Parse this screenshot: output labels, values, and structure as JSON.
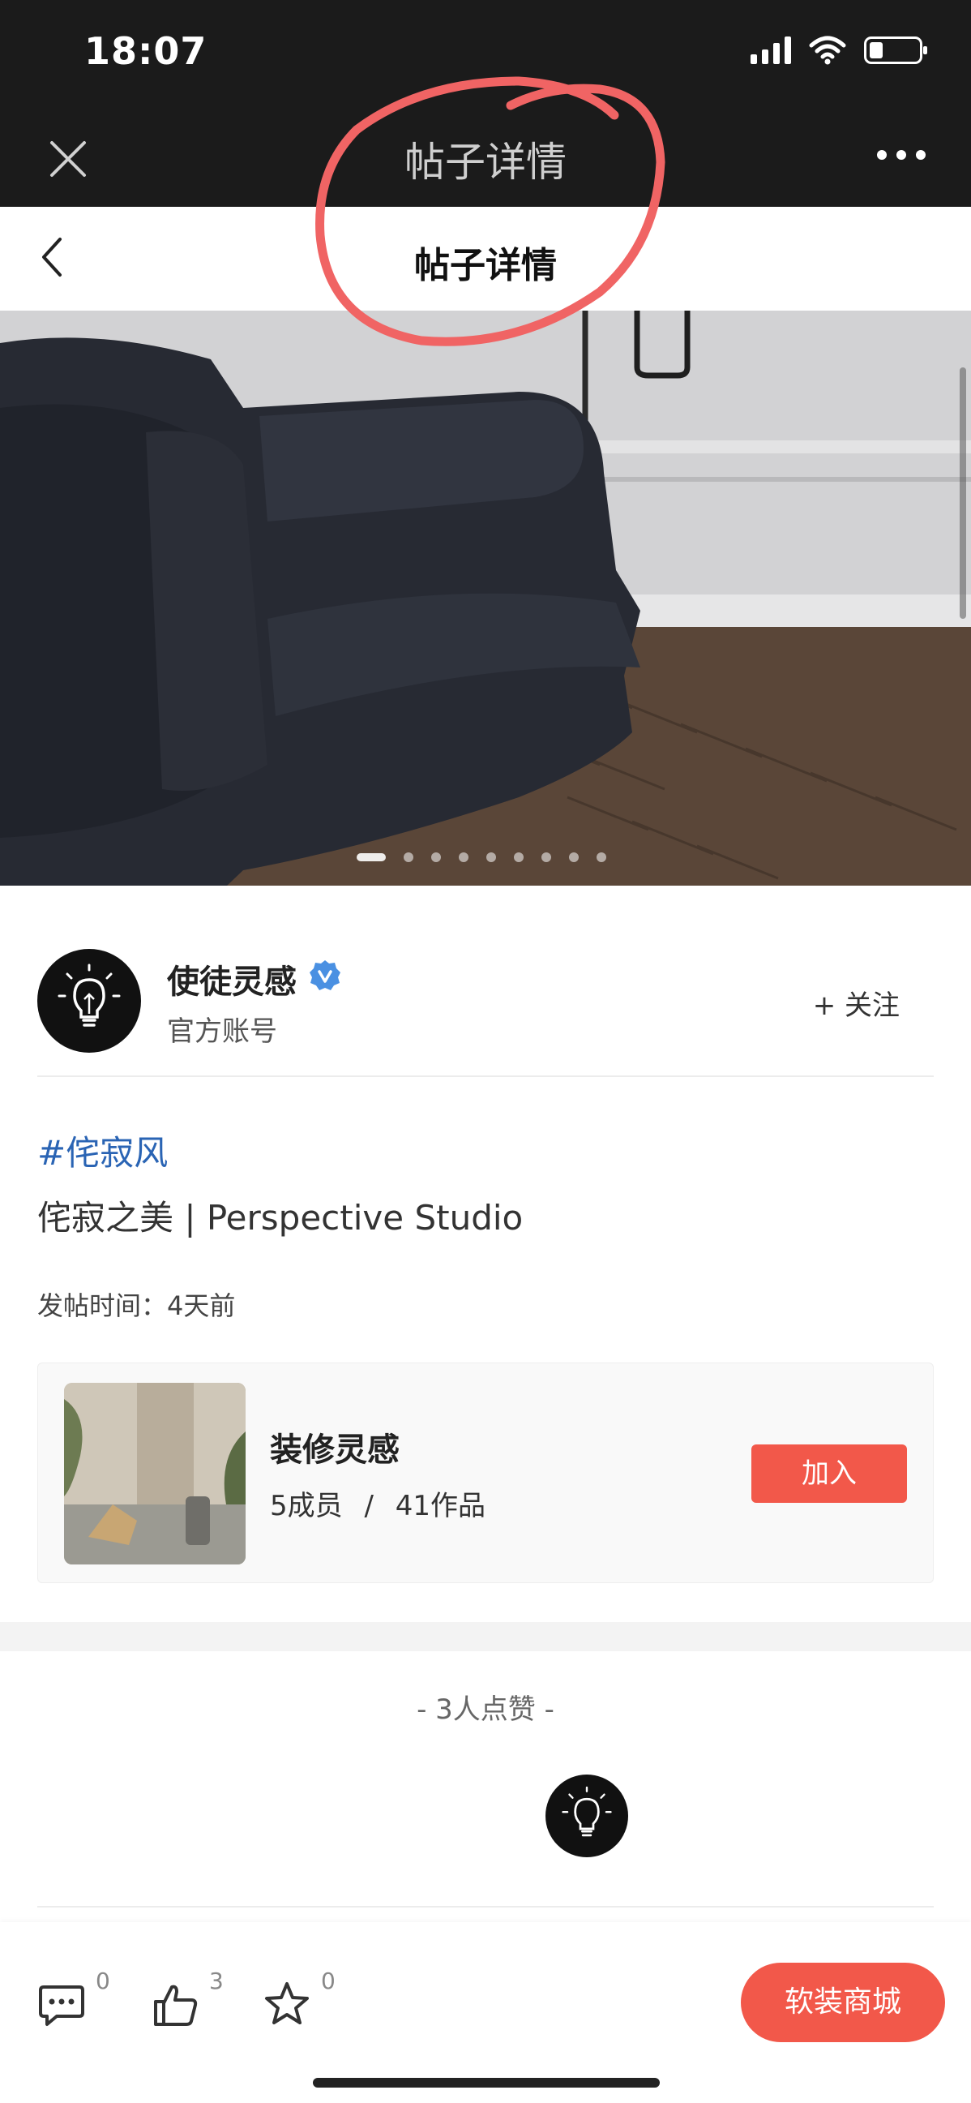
{
  "status_bar": {
    "time": "18:07"
  },
  "wechat_bar": {
    "title": "帖子详情"
  },
  "header": {
    "title": "帖子详情"
  },
  "hero": {
    "image_count": 9,
    "active_index": 0
  },
  "author": {
    "name": "使徒灵感",
    "subtitle": "官方账号",
    "follow_label": "+ 关注"
  },
  "post": {
    "hashtag": "#侘寂风",
    "text": "侘寂之美 | Perspective Studio",
    "time_label": "发帖时间：",
    "time_value": "4天前"
  },
  "community": {
    "title": "装修灵感",
    "members": "5成员",
    "separator": "/",
    "works": "41作品",
    "join_label": "加入"
  },
  "likes": {
    "title": "- 3人点赞 -"
  },
  "bottom_bar": {
    "comments": "0",
    "likes": "3",
    "favorites": "0",
    "shop_label": "软装商城"
  },
  "colors": {
    "accent": "#f2584a",
    "hashtag": "#2a64b4",
    "annotation": "#f06464"
  }
}
